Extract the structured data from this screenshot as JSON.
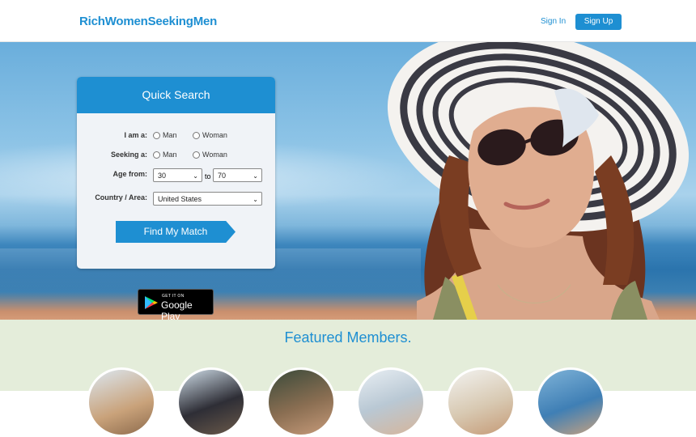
{
  "header": {
    "logo": "RichWomenSeekingMen",
    "sign_in": "Sign In",
    "sign_up": "Sign Up"
  },
  "search": {
    "title": "Quick Search",
    "iam_label": "I am a:",
    "seeking_label": "Seeking a:",
    "age_label": "Age from:",
    "country_label": "Country / Area:",
    "man": "Man",
    "woman": "Woman",
    "age_from": "30",
    "age_to_word": "to",
    "age_to": "70",
    "country": "United States",
    "button": "Find My Match"
  },
  "gplay": {
    "small": "GET IT ON",
    "big": "Google Play"
  },
  "featured": {
    "title": "Featured Members."
  },
  "colors": {
    "accent": "#1e8fd2",
    "featured_bg": "#e4edda"
  }
}
